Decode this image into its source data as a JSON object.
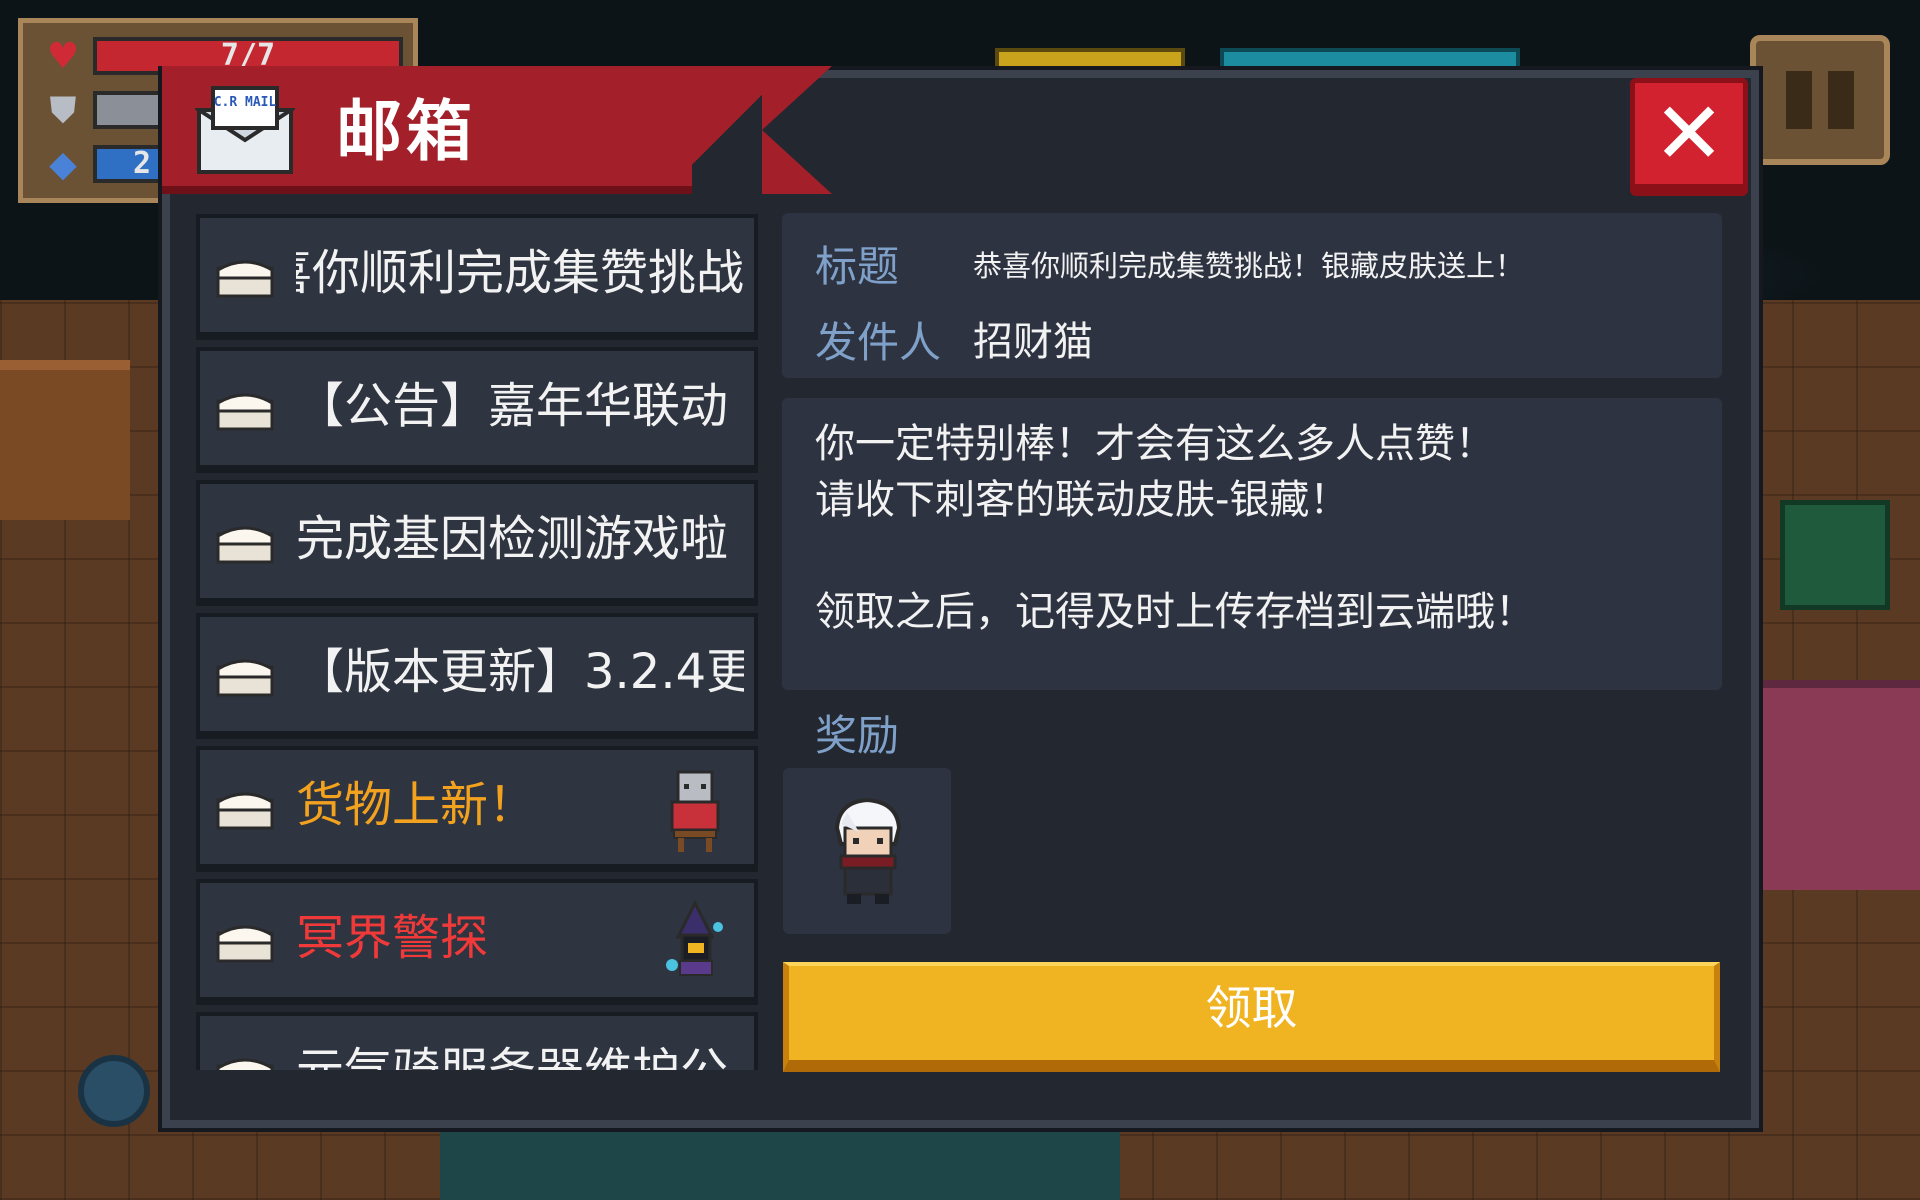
{
  "hud": {
    "health_text": "7/7",
    "health_ratio": 1.0,
    "armor_ratio": 1.0,
    "energy_text": "2",
    "energy_ratio": 1.0,
    "health_color": "#c4272f",
    "armor_color": "#8a8f98",
    "energy_color": "#2f6fc4"
  },
  "window": {
    "title": "邮箱",
    "mail_icon_text": "C.R MAIL",
    "header_color": "#a3202a",
    "panel_color": "#232730"
  },
  "mail_list": {
    "items": [
      {
        "label": "恭喜你顺利完成集赞挑战！",
        "color": "#f2f2f2",
        "has_thumb": false
      },
      {
        "label": "【公告】嘉年华联动",
        "color": "#f2f2f2",
        "has_thumb": false
      },
      {
        "label": "完成基因检测游戏啦",
        "color": "#f2f2f2",
        "has_thumb": false
      },
      {
        "label": "【版本更新】3.2.4更",
        "color": "#f2f2f2",
        "has_thumb": false
      },
      {
        "label": "货物上新！",
        "color": "#f2a21e",
        "has_thumb": true,
        "thumb": "cat-merchant-icon"
      },
      {
        "label": "冥界警探",
        "color": "#f03a3a",
        "has_thumb": true,
        "thumb": "ghost-detective-icon"
      },
      {
        "label": "元气骑服务器维护公",
        "color": "#f2f2f2",
        "has_thumb": false
      }
    ]
  },
  "detail": {
    "title_label": "标题",
    "title_value": "恭喜你顺利完成集赞挑战！银藏皮肤送上！",
    "sender_label": "发件人",
    "sender_value": "招财猫",
    "body_lines": [
      "你一定特别棒！才会有这么多人点赞！",
      "请收下刺客的联动皮肤-银藏！",
      "",
      "领取之后，记得及时上传存档到云端哦！"
    ],
    "reward_label": "奖励",
    "reward_item": "silver-hair-assassin-skin-icon",
    "claim_button": "领取",
    "claim_color": "#f0b322"
  },
  "icons": {
    "close": "close-icon",
    "pause": "pause-icon",
    "heart": "heart-icon",
    "shield": "shield-icon",
    "energy": "energy-gem-icon",
    "envelope": "envelope-icon"
  }
}
